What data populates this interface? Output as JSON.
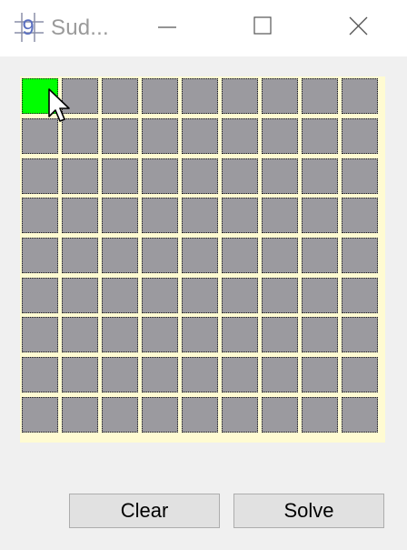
{
  "window": {
    "title": "Sud...",
    "icon_glyph": "9",
    "controls": [
      "minimize-icon",
      "maximize-icon",
      "close-icon"
    ]
  },
  "board": {
    "rows": 9,
    "cols": 9,
    "selected_cell": {
      "row": 0,
      "col": 0
    },
    "values": [
      [
        "",
        "",
        "",
        "",
        "",
        "",
        "",
        "",
        ""
      ],
      [
        "",
        "",
        "",
        "",
        "",
        "",
        "",
        "",
        ""
      ],
      [
        "",
        "",
        "",
        "",
        "",
        "",
        "",
        "",
        ""
      ],
      [
        "",
        "",
        "",
        "",
        "",
        "",
        "",
        "",
        ""
      ],
      [
        "",
        "",
        "",
        "",
        "",
        "",
        "",
        "",
        ""
      ],
      [
        "",
        "",
        "",
        "",
        "",
        "",
        "",
        "",
        ""
      ],
      [
        "",
        "",
        "",
        "",
        "",
        "",
        "",
        "",
        ""
      ],
      [
        "",
        "",
        "",
        "",
        "",
        "",
        "",
        "",
        ""
      ],
      [
        "",
        "",
        "",
        "",
        "",
        "",
        "",
        "",
        ""
      ]
    ]
  },
  "colors": {
    "cell": "#9b9a9f",
    "selected_cell": "#00ff00",
    "board_background": "#fffbd2"
  },
  "buttons": {
    "clear_label": "Clear",
    "solve_label": "Solve"
  }
}
